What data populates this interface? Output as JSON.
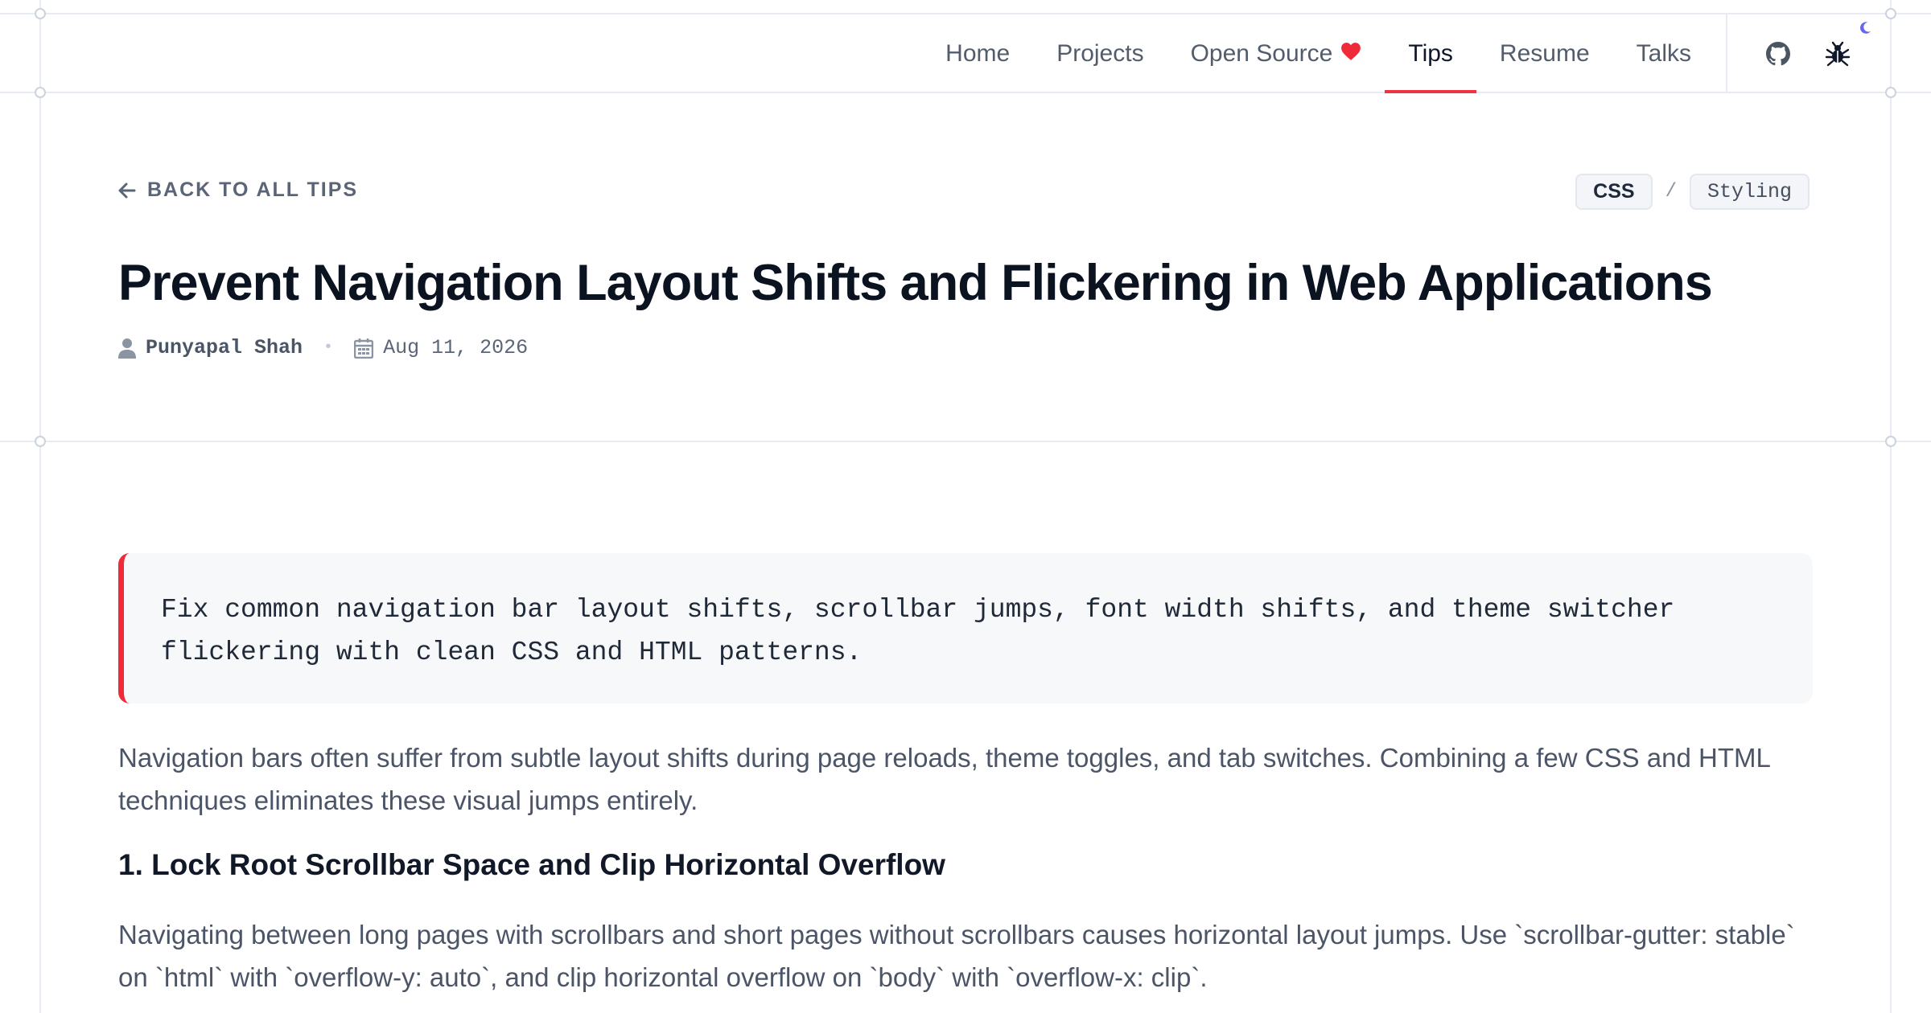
{
  "nav": {
    "links": [
      {
        "label": "Home",
        "active": false
      },
      {
        "label": "Projects",
        "active": false
      },
      {
        "label": "Open Source",
        "active": false
      },
      {
        "label": "Tips",
        "active": true
      },
      {
        "label": "Resume",
        "active": false
      },
      {
        "label": "Talks",
        "active": false
      }
    ],
    "icons": [
      "github-icon",
      "bug-icon",
      "moon-icon",
      "heart-icon"
    ]
  },
  "back_link": "BACK TO ALL TIPS",
  "tags": {
    "primary": "CSS",
    "separator": "/",
    "secondary": "Styling"
  },
  "article": {
    "title": "Prevent Navigation Layout Shifts and Flickering in Web Applications",
    "author": "Punyapal Shah",
    "separator": "•",
    "date": "Aug 11, 2026",
    "summary": "Fix common navigation bar layout shifts, scrollbar jumps, font width shifts, and theme switcher flickering with clean CSS and HTML patterns.",
    "intro": "Navigation bars often suffer from subtle layout shifts during page reloads, theme toggles, and tab switches. Combining a few CSS and HTML techniques eliminates these visual jumps entirely.",
    "section_heading": "1. Lock Root Scrollbar Space and Clip Horizontal Overflow",
    "section_body": "Navigating between long pages with scrollbars and short pages without scrollbars causes horizontal layout jumps. Use `scrollbar-gutter: stable` on `html` with `overflow-y: auto`, and clip horizontal overflow on `body` with `overflow-x: clip`."
  },
  "colors": {
    "accent": "#ef3340",
    "moon": "#6366f1",
    "callout_bg": "#f6f8fa"
  }
}
